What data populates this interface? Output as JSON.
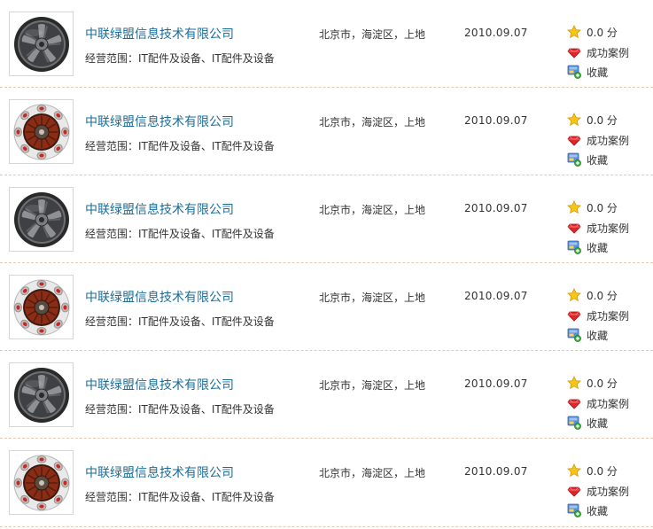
{
  "colors": {
    "title_link": "#1b6e9b",
    "text": "#333333",
    "divider": "#e8c9b0"
  },
  "companies": [
    {
      "image": "alloy-wheel-gray",
      "name": "中联绿盟信息技术有限公司",
      "scope_label": "经营范围：",
      "scope": "IT配件及设备、IT配件及设备",
      "location": "北京市，海淀区，上地",
      "date": "2010.09.07",
      "rating": "0.0 分",
      "cases_label": "成功案例",
      "favorite_label": "收藏"
    },
    {
      "image": "ornate-red-wheel",
      "name": "中联绿盟信息技术有限公司",
      "scope_label": "经营范围：",
      "scope": "IT配件及设备、IT配件及设备",
      "location": "北京市，海淀区，上地",
      "date": "2010.09.07",
      "rating": "0.0 分",
      "cases_label": "成功案例",
      "favorite_label": "收藏"
    },
    {
      "image": "alloy-wheel-gray",
      "name": "中联绿盟信息技术有限公司",
      "scope_label": "经营范围：",
      "scope": "IT配件及设备、IT配件及设备",
      "location": "北京市，海淀区，上地",
      "date": "2010.09.07",
      "rating": "0.0 分",
      "cases_label": "成功案例",
      "favorite_label": "收藏"
    },
    {
      "image": "ornate-red-wheel",
      "name": "中联绿盟信息技术有限公司",
      "scope_label": "经营范围：",
      "scope": "IT配件及设备、IT配件及设备",
      "location": "北京市，海淀区，上地",
      "date": "2010.09.07",
      "rating": "0.0 分",
      "cases_label": "成功案例",
      "favorite_label": "收藏"
    },
    {
      "image": "alloy-wheel-gray",
      "name": "中联绿盟信息技术有限公司",
      "scope_label": "经营范围：",
      "scope": "IT配件及设备、IT配件及设备",
      "location": "北京市，海淀区，上地",
      "date": "2010.09.07",
      "rating": "0.0 分",
      "cases_label": "成功案例",
      "favorite_label": "收藏"
    },
    {
      "image": "ornate-red-wheel",
      "name": "中联绿盟信息技术有限公司",
      "scope_label": "经营范围：",
      "scope": "IT配件及设备、IT配件及设备",
      "location": "北京市，海淀区，上地",
      "date": "2010.09.07",
      "rating": "0.0 分",
      "cases_label": "成功案例",
      "favorite_label": "收藏"
    }
  ]
}
